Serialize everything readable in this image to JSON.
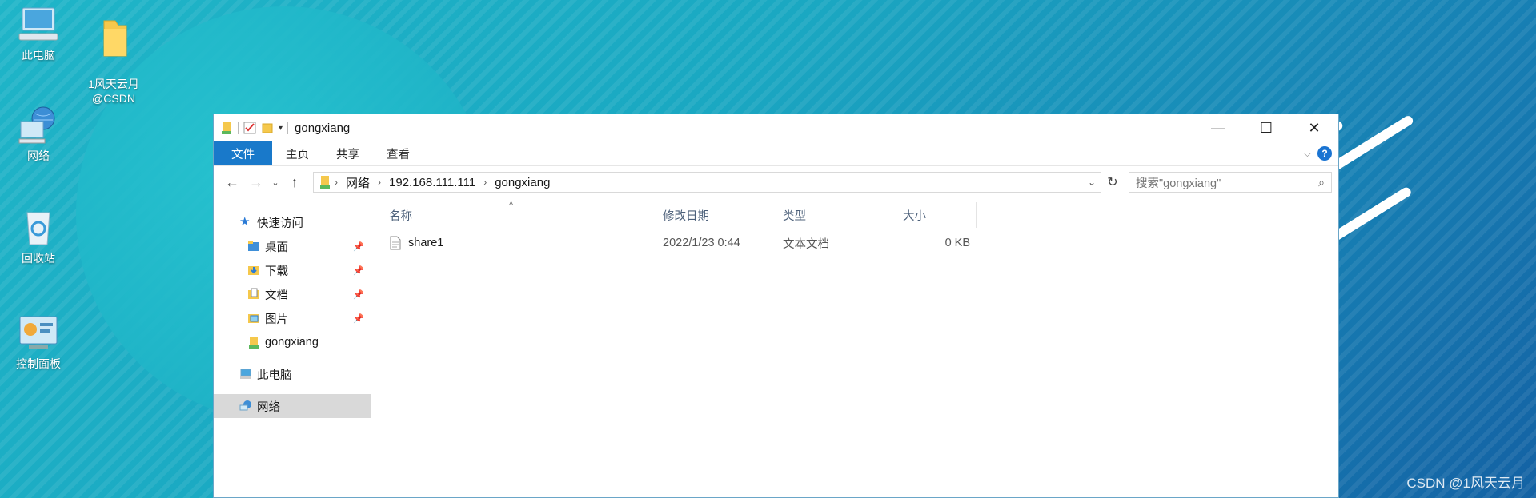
{
  "desktop": {
    "icons": [
      {
        "label": "此电脑",
        "icon": "this-pc-icon"
      },
      {
        "label": "1风天云月\n@CSDN",
        "icon": "folder-icon"
      },
      {
        "label": "网络",
        "icon": "network-icon"
      },
      {
        "label": "回收站",
        "icon": "recycle-bin-icon"
      },
      {
        "label": "控制面板",
        "icon": "control-panel-icon"
      }
    ],
    "watermark": "CSDN @1风天云月"
  },
  "window": {
    "title": "gongxiang",
    "controls": {
      "minimize": "—",
      "maximize": "☐",
      "close": "✕"
    },
    "ribbon_tabs": [
      "文件",
      "主页",
      "共享",
      "查看"
    ],
    "address": {
      "crumbs": [
        "网络",
        "192.168.111.111",
        "gongxiang"
      ]
    },
    "search_placeholder": "搜索\"gongxiang\"",
    "nav_pane": {
      "quick_access": "快速访问",
      "items": [
        "桌面",
        "下载",
        "文档",
        "图片",
        "gongxiang"
      ],
      "this_pc": "此电脑",
      "network": "网络"
    },
    "columns": [
      "名称",
      "修改日期",
      "类型",
      "大小"
    ],
    "files": [
      {
        "name": "share1",
        "modified": "2022/1/23 0:44",
        "type": "文本文档",
        "size": "0 KB"
      }
    ]
  }
}
